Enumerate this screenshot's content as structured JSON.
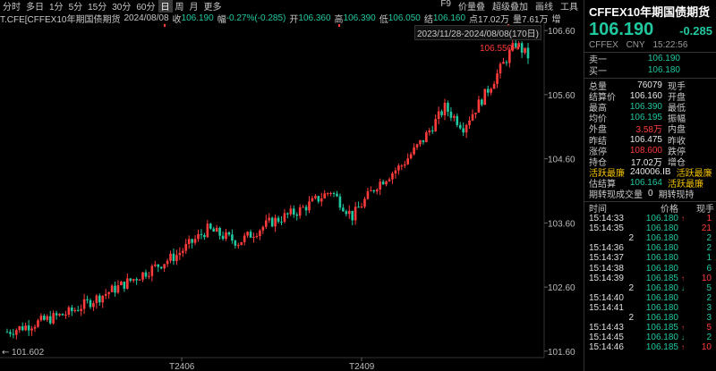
{
  "toolbar": {
    "periods": [
      "分时",
      "多日",
      "1分",
      "5分",
      "15分",
      "30分",
      "60分",
      "日",
      "周",
      "月",
      "更多"
    ],
    "selected": "日",
    "tools": [
      "F9",
      "价量叠",
      "超级叠加",
      "画线",
      "工具"
    ]
  },
  "infobar": {
    "symbol": "T.CFE[CFFEX10年期国债期货",
    "date": "2024/08/08",
    "close_label": "收",
    "close": "106.190",
    "chg_label": "幅",
    "chg": "-0.27%(-0.285)",
    "open_label": "开",
    "open": "106.360",
    "high_label": "高",
    "high": "106.390",
    "low_label": "低",
    "low": "106.050",
    "last_label": "结",
    "last": "106.160",
    "amt_label": "点",
    "amt": "17.02万",
    "vol_label": "量",
    "vol": "7.61万",
    "more": "增"
  },
  "range_text": "2023/11/28-2024/08/08(170日)",
  "chart_data": {
    "type": "candlestick",
    "y_ticks": [
      "106.60",
      "105.60",
      "104.60",
      "103.60",
      "102.60",
      "101.60"
    ],
    "y_tick_values": [
      106.6,
      105.6,
      104.6,
      103.6,
      102.6,
      101.6
    ],
    "ylim": [
      101.5,
      106.7
    ],
    "x_labels": [
      "T2406",
      "T2409"
    ],
    "max_label": "106.550",
    "min_label": "101.602",
    "min_arrow": "←",
    "max_arrow": "→",
    "colors": {
      "up": "#ff3b3b",
      "down": "#20c8a0"
    }
  },
  "panel": {
    "title": "CFFEX10年期国债期货",
    "price": "106.190",
    "change": "-0.285",
    "exchange": "CFFEX",
    "currency": "CNY",
    "time": "15:22:56",
    "sell_label": "卖一",
    "sell": "106.190",
    "buy_label": "买一",
    "buy": "106.180",
    "stats": [
      {
        "k": "总量",
        "v": "76079",
        "c": "white",
        "k2": "现手"
      },
      {
        "k": "结算价",
        "v": "106.160",
        "c": "white",
        "k2": "开盘"
      },
      {
        "k": "最高",
        "v": "106.390",
        "c": "green",
        "k2": "最低"
      },
      {
        "k": "均价",
        "v": "106.195",
        "c": "green",
        "k2": "振幅"
      },
      {
        "k": "外盘",
        "v": "3.58万",
        "c": "red",
        "k2": "内盘"
      },
      {
        "k": "昨结",
        "v": "106.475",
        "c": "white",
        "k2": "昨收"
      },
      {
        "k": "涨停",
        "v": "108.600",
        "c": "red",
        "k2": "跌停"
      },
      {
        "k": "持仓",
        "v": "17.02万",
        "c": "white",
        "k2": "增仓"
      },
      {
        "k": "活跃最廉",
        "v": "240006.IB",
        "c": "white",
        "k2": "活跃最廉",
        "kc": "yellow",
        "k2c": "yellow"
      },
      {
        "k": "估结算",
        "v": "106.164",
        "c": "green",
        "k2": "活跃最廉",
        "k2c": "yellow"
      },
      {
        "k": "期转现成交量",
        "v": "0",
        "c": "white",
        "k2": "期转现持"
      }
    ],
    "ticks_head": [
      "时间",
      "价格",
      "现手"
    ],
    "ticks": [
      {
        "t": "15:14:33",
        "p": "106.180",
        "a": "↑",
        "ac": "red",
        "q": "1",
        "qc": "red"
      },
      {
        "t": "15:14:35",
        "p": "106.180",
        "a": "",
        "ac": "",
        "q": "21",
        "qc": "red"
      },
      {
        "t": "2",
        "p": "106.180",
        "a": "",
        "ac": "",
        "q": "2",
        "qc": "green"
      },
      {
        "t": "15:14:36",
        "p": "106.180",
        "a": "",
        "ac": "",
        "q": "2",
        "qc": "green"
      },
      {
        "t": "15:14:37",
        "p": "106.180",
        "a": "",
        "ac": "",
        "q": "1",
        "qc": "green"
      },
      {
        "t": "15:14:38",
        "p": "106.180",
        "a": "",
        "ac": "",
        "q": "6",
        "qc": "green"
      },
      {
        "t": "15:14:39",
        "p": "106.185",
        "a": "↑",
        "ac": "red",
        "q": "10",
        "qc": "red"
      },
      {
        "t": "2",
        "p": "106.180",
        "a": "↓",
        "ac": "green",
        "q": "5",
        "qc": "green"
      },
      {
        "t": "15:14:40",
        "p": "106.180",
        "a": "",
        "ac": "",
        "q": "2",
        "qc": "green"
      },
      {
        "t": "15:14:41",
        "p": "106.180",
        "a": "",
        "ac": "",
        "q": "3",
        "qc": "green"
      },
      {
        "t": "2",
        "p": "106.180",
        "a": "",
        "ac": "",
        "q": "3",
        "qc": "green"
      },
      {
        "t": "15:14:43",
        "p": "106.185",
        "a": "↑",
        "ac": "red",
        "q": "5",
        "qc": "red"
      },
      {
        "t": "15:14:45",
        "p": "106.180",
        "a": "↓",
        "ac": "green",
        "q": "2",
        "qc": "green"
      },
      {
        "t": "15:14:46",
        "p": "106.185",
        "a": "↑",
        "ac": "red",
        "q": "10",
        "qc": "red"
      }
    ]
  }
}
